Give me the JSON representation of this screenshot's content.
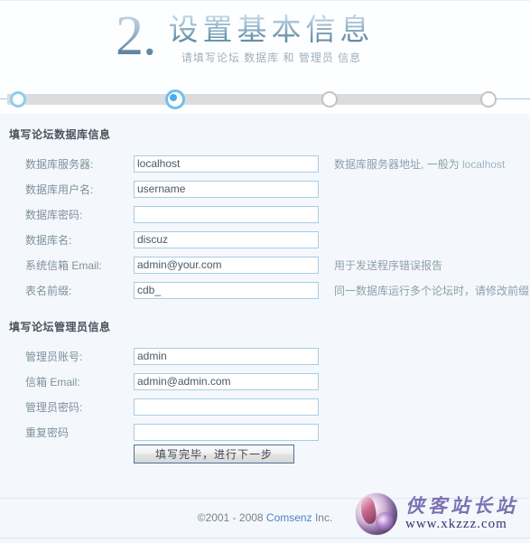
{
  "header": {
    "step_numeral": "2.",
    "title": "设置基本信息",
    "subtitle": "请填写论坛 数据库 和 管理员 信息"
  },
  "stepper": {
    "nodes": [
      {
        "name": "step-1",
        "state": "done"
      },
      {
        "name": "step-2",
        "state": "active"
      },
      {
        "name": "step-3",
        "state": "todo"
      },
      {
        "name": "step-4",
        "state": "todo"
      }
    ],
    "active_index": 2,
    "total": 4,
    "colors": {
      "active": "#45aee8",
      "done_ring": "#8dcdf0",
      "todo_ring": "#c3c3c3",
      "bar": "#dcdcdc",
      "line": "#a7cbe2"
    }
  },
  "db_section": {
    "title": "填写论坛数据库信息",
    "fields": [
      {
        "label": "数据库服务器:",
        "value": "localhost",
        "placeholder": "",
        "type": "text",
        "hint": "数据库服务器地址, 一般为 ",
        "hint_mono": "localhost",
        "name": "db-host"
      },
      {
        "label": "数据库用户名:",
        "value": "username",
        "placeholder": "",
        "type": "text",
        "hint": "",
        "hint_mono": "",
        "name": "db-user"
      },
      {
        "label": "数据库密码:",
        "value": "",
        "placeholder": "",
        "type": "password",
        "hint": "",
        "hint_mono": "",
        "name": "db-password"
      },
      {
        "label": "数据库名:",
        "value": "discuz",
        "placeholder": "",
        "type": "text",
        "hint": "",
        "hint_mono": "",
        "name": "db-name"
      },
      {
        "label": "系统信箱 Email:",
        "value": "admin@your.com",
        "placeholder": "",
        "type": "text",
        "hint": "用于发送程序错误报告",
        "hint_mono": "",
        "name": "system-email"
      },
      {
        "label": "表名前缀:",
        "value": "cdb_",
        "placeholder": "",
        "type": "text",
        "hint": "同一数据库运行多个论坛时，请修改前缀",
        "hint_mono": "",
        "name": "table-prefix"
      }
    ]
  },
  "admin_section": {
    "title": "填写论坛管理员信息",
    "fields": [
      {
        "label": "管理员账号:",
        "value": "admin",
        "placeholder": "",
        "type": "text",
        "hint": "",
        "hint_mono": "",
        "name": "admin-username"
      },
      {
        "label": "信箱 Email:",
        "value": "admin@admin.com",
        "placeholder": "",
        "type": "text",
        "hint": "",
        "hint_mono": "",
        "name": "admin-email"
      },
      {
        "label": "管理员密码:",
        "value": "",
        "placeholder": "",
        "type": "password",
        "hint": "",
        "hint_mono": "",
        "name": "admin-password"
      },
      {
        "label": "重复密码",
        "value": "",
        "placeholder": "",
        "type": "password",
        "hint": "",
        "hint_mono": "",
        "name": "admin-password-confirm"
      }
    ]
  },
  "submit": {
    "label": "填写完毕，进行下一步"
  },
  "footer": {
    "copyright_prefix": "©2001 - 2008 ",
    "brand": "Comsenz",
    "copyright_suffix": " Inc."
  },
  "watermark": {
    "cn_text": "侠客站长站",
    "url_text": "www.xkzzz.com"
  }
}
